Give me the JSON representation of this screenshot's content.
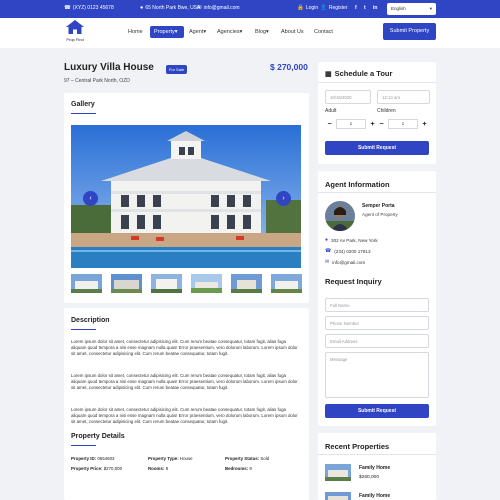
{
  "topbar": {
    "phone": "(XYZ) 0123 45678",
    "address": "65 North Park Bwe, USA",
    "email": "info@gmail.com",
    "login": "Login",
    "register": "Register",
    "social": [
      "f",
      "t",
      "in"
    ],
    "language": "English"
  },
  "brand": {
    "logo_text": "Prop Find"
  },
  "nav": {
    "items": [
      "Home",
      "Property",
      "Agent",
      "Agencies",
      "Blog",
      "About Us",
      "Contact"
    ],
    "active": "Property",
    "submit_label": "Submit Property"
  },
  "listing": {
    "title": "Luxury Villa House",
    "badge": "For Sale",
    "address": "97 – Central Park North, OZD",
    "price": "$ 270,000"
  },
  "gallery": {
    "title": "Gallery",
    "thumb_count": 6
  },
  "description": {
    "title": "Description",
    "paragraphs": [
      "Lorem ipsum dolor sit amet, consectetur adipisicing elit. Cum rerum beatae consequatur, totam fugit, alias fuga aliquam quod tempora a nisi esse magnam nulla quas! Error praesentium, vero dolorum laborum. Lorem ipsum dolor sit amet, consectetur adipisicing elit. Cum rerum beatae consequatur, totam fugit.",
      "Lorem ipsum dolor sit amet, consectetur adipisicing elit. Cum rerum beatae consequatur, totam fugit, alias fuga aliquam quod tempora a nisi esse magnam nulla quas! Error praesentium, vero dolorum laborum. Lorem ipsum dolor sit amet, consectetur adipisicing elit. Cum rerum beatae consequatur, totam fugit.",
      "Lorem ipsum dolor sit amet, consectetur adipisicing elit. Cum rerum beatae consequatur, totam fugit, alias fuga aliquam quod tempora a nisi esse magnam nulla quas! Error praesentium, vero dolorum laborum. Lorem ipsum dolor sit amet, consectetur adipisicing elit. Cum rerum beatae consequatur, totam fugit."
    ]
  },
  "details": {
    "title": "Property Details",
    "rows": [
      [
        {
          "k": "Property ID:",
          "v": " 0654603"
        },
        {
          "k": "Property Type:",
          "v": " House"
        },
        {
          "k": "Property Status:",
          "v": " Sold"
        }
      ],
      [
        {
          "k": "Property Price:",
          "v": " $270,000"
        },
        {
          "k": "Rooms:",
          "v": " 8"
        },
        {
          "k": "Bedrooms:",
          "v": " 9"
        }
      ]
    ]
  },
  "tour": {
    "title": "Schedule a Tour",
    "date": "10/16/2020",
    "time": "12:13 am",
    "adult_label": "Adult",
    "children_label": "Children",
    "adult_value": "1",
    "children_value": "1",
    "button": "Submit Request"
  },
  "agent": {
    "title": "Agent Information",
    "name": "Semper Porta",
    "role": "Agent of Property",
    "address": "302 Av Park, New York",
    "phone": "(234) 0200 17813",
    "email": "info@gmail.com"
  },
  "inquiry": {
    "title": "Request Inquiry",
    "full_name": "Full Name",
    "phone": "Phone Number",
    "email": "Email Address",
    "message": "Message",
    "button": "Submit Request"
  },
  "recent": {
    "title": "Recent Properties",
    "items": [
      {
        "name": "Family Home",
        "price": "$260,000"
      },
      {
        "name": "Family Home",
        "price": ""
      }
    ]
  },
  "colors": {
    "primary": "#2f45c4",
    "background": "#f1f2f6"
  },
  "icons": [
    "phone-icon",
    "map-pin-icon",
    "mail-icon",
    "user-icon",
    "calendar-icon",
    "chevron-left-icon",
    "chevron-right-icon"
  ]
}
